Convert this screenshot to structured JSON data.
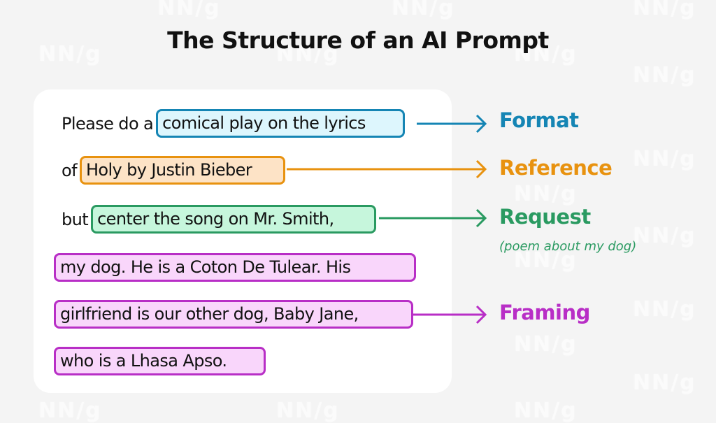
{
  "title": "The Structure of an AI Prompt",
  "watermark": "NN/g",
  "colors": {
    "format": "#1585b4",
    "reference": "#e8920f",
    "request": "#2a9a61",
    "framing": "#b82ec6"
  },
  "prompt_lines": [
    {
      "prefix": "Please do a",
      "highlight": "comical play on the lyrics",
      "category": "format"
    },
    {
      "prefix": "of",
      "highlight": "Holy by Justin Bieber",
      "category": "reference"
    },
    {
      "prefix": "but",
      "highlight": "center the song on Mr. Smith,",
      "category": "request"
    },
    {
      "prefix": "",
      "highlight": "my dog. He is a Coton De Tulear. His",
      "category": "framing"
    },
    {
      "prefix": "",
      "highlight": "girlfriend is our other dog, Baby Jane,",
      "category": "framing"
    },
    {
      "prefix": "",
      "highlight": "who is a Lhasa Apso.",
      "category": "framing"
    }
  ],
  "labels": {
    "format": "Format",
    "reference": "Reference",
    "request": "Request",
    "request_note": "(poem about my dog)",
    "framing": "Framing"
  }
}
